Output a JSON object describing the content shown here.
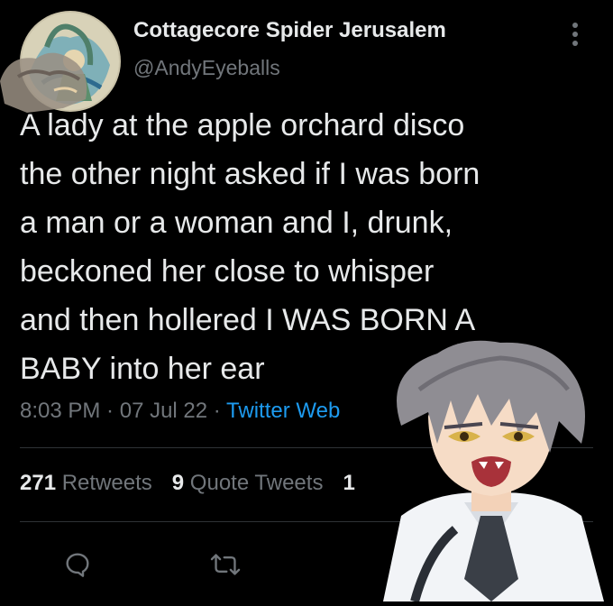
{
  "author": {
    "name": "Cottagecore Spider Jerusalem",
    "handle": "@AndyEyeballs"
  },
  "tweet": {
    "text": "A lady at the apple orchard disco\nthe other night asked if I was born\na man or a woman and I, drunk,\nbeckoned her close to whisper\nand then hollered I WAS BORN A\nBABY into her ear"
  },
  "meta": {
    "time": "8:03 PM",
    "separator": " · ",
    "date": "07 Jul 22",
    "source": "Twitter Web"
  },
  "stats": {
    "retweets_count": "271",
    "retweets_label": "Retweets",
    "quotes_count": "9",
    "quotes_label": "Quote Tweets",
    "likes_partial": "1"
  },
  "icons": {
    "more": "more-vertical-icon",
    "reply": "reply-icon",
    "retweet": "retweet-icon"
  },
  "colors": {
    "background": "#000000",
    "text": "#e7e9ea",
    "muted": "#71767b",
    "link": "#1d9bf0",
    "divider": "#2f3336"
  }
}
